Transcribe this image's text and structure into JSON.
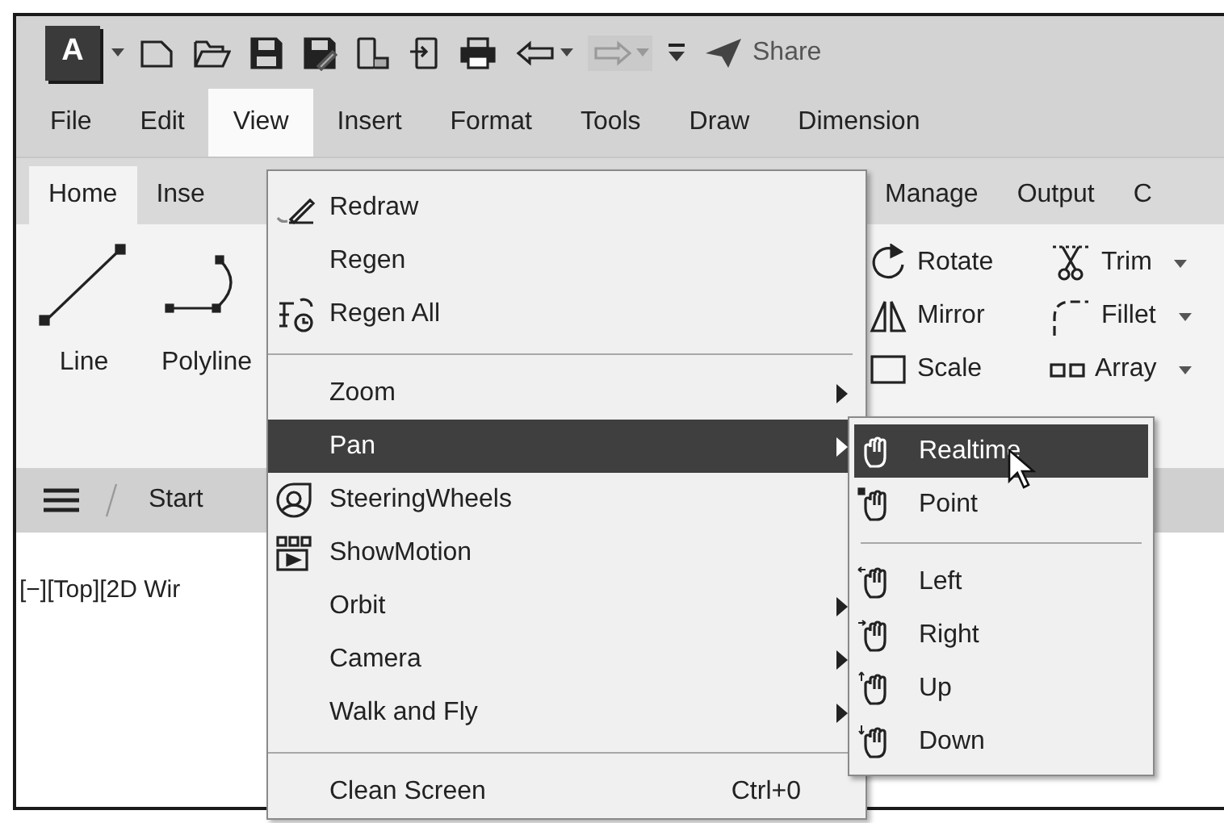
{
  "quick_access_toolbar": {
    "app_button": "A",
    "tools": [
      {
        "kind": "new",
        "disabled": false
      },
      {
        "kind": "open",
        "disabled": false
      },
      {
        "kind": "save",
        "disabled": false
      },
      {
        "kind": "save-as",
        "disabled": false
      },
      {
        "kind": "publish",
        "disabled": false
      },
      {
        "kind": "import",
        "disabled": false
      },
      {
        "kind": "plot",
        "disabled": false
      },
      {
        "kind": "undo",
        "disabled": false
      },
      {
        "kind": "redo",
        "disabled": true
      },
      {
        "kind": "customize",
        "disabled": false
      }
    ],
    "share": "Share"
  },
  "menu_bar": [
    {
      "label": "File",
      "selected": false
    },
    {
      "label": "Edit",
      "selected": false
    },
    {
      "label": "View",
      "selected": true
    },
    {
      "label": "Insert",
      "selected": false
    },
    {
      "label": "Format",
      "selected": false
    },
    {
      "label": "Tools",
      "selected": false
    },
    {
      "label": "Draw",
      "selected": false
    },
    {
      "label": "Dimension",
      "selected": false
    }
  ],
  "ribbon_tabs": [
    {
      "label": "Home",
      "selected": true
    },
    {
      "label": "Inse",
      "selected": false
    },
    {
      "label": "Manage",
      "selected": false
    },
    {
      "label": "Output",
      "selected": false
    },
    {
      "label": "C",
      "selected": false
    }
  ],
  "ribbon": {
    "draw_tools": [
      {
        "kind": "line",
        "label": "Line"
      },
      {
        "kind": "polyline",
        "label": "Polyline"
      }
    ],
    "modify_tools": [
      {
        "kind": "rotate",
        "label": "Rotate",
        "dropdown": false
      },
      {
        "kind": "trim",
        "label": "Trim",
        "dropdown": true
      },
      {
        "kind": "mirror",
        "label": "Mirror",
        "dropdown": false
      },
      {
        "kind": "fillet",
        "label": "Fillet",
        "dropdown": true
      },
      {
        "kind": "scale",
        "label": "Scale",
        "dropdown": false
      },
      {
        "kind": "array",
        "label": "Array",
        "dropdown": true
      }
    ]
  },
  "file_tabs": {
    "tabs": [
      {
        "label": "Start"
      }
    ]
  },
  "viewport": {
    "label": "[−][Top][2D Wir"
  },
  "view_menu": {
    "items": [
      {
        "kind": "pencil",
        "label": "Redraw",
        "submenu": false,
        "selected": false
      },
      {
        "kind": "plain",
        "label": "Regen",
        "submenu": false,
        "selected": false
      },
      {
        "kind": "regen",
        "label": "Regen All",
        "submenu": false,
        "selected": false
      },
      {
        "kind": "separator"
      },
      {
        "kind": "plain",
        "label": "Zoom",
        "submenu": true,
        "selected": false
      },
      {
        "kind": "plain",
        "label": "Pan",
        "submenu": true,
        "selected": true
      },
      {
        "kind": "wheel",
        "label": "SteeringWheels",
        "submenu": false,
        "selected": false
      },
      {
        "kind": "motion",
        "label": "ShowMotion",
        "submenu": false,
        "selected": false
      },
      {
        "kind": "plain",
        "label": "Orbit",
        "submenu": true,
        "selected": false
      },
      {
        "kind": "plain",
        "label": "Camera",
        "submenu": true,
        "selected": false
      },
      {
        "kind": "plain",
        "label": "Walk and Fly",
        "submenu": true,
        "selected": false
      },
      {
        "kind": "separator"
      },
      {
        "kind": "plain",
        "label": "Clean Screen",
        "shortcut": "Ctrl+0",
        "submenu": false,
        "selected": false
      }
    ]
  },
  "pan_submenu": {
    "items": [
      {
        "kind": "hand",
        "label": "Realtime",
        "selected": true
      },
      {
        "kind": "hand-point",
        "label": "Point",
        "selected": false
      },
      {
        "kind": "separator"
      },
      {
        "kind": "hand-left",
        "label": "Left",
        "selected": false
      },
      {
        "kind": "hand-right",
        "label": "Right",
        "selected": false
      },
      {
        "kind": "hand-up",
        "label": "Up",
        "selected": false
      },
      {
        "kind": "hand-down",
        "label": "Down",
        "selected": false
      }
    ]
  }
}
